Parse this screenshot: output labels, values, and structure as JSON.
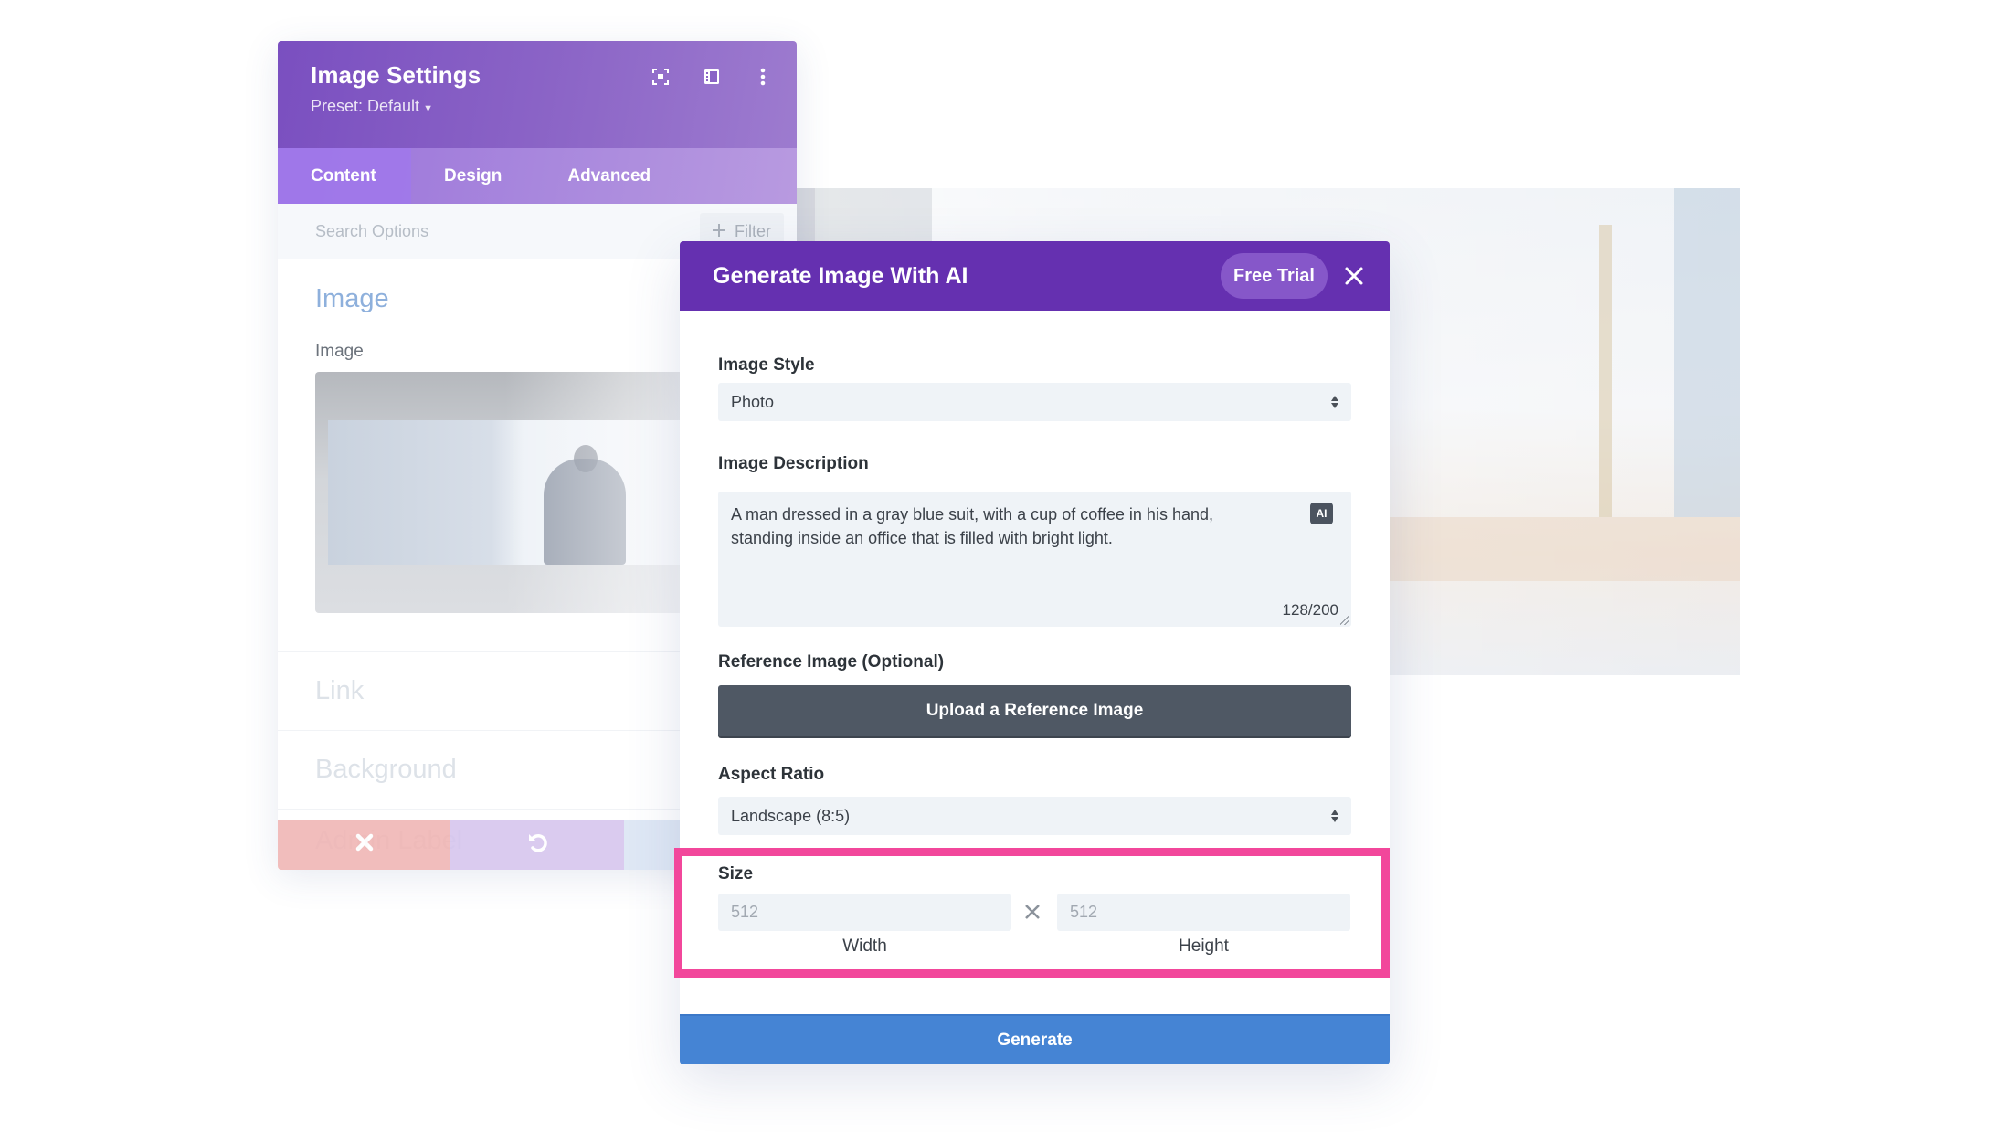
{
  "settings_panel": {
    "title": "Image Settings",
    "preset": "Preset: Default",
    "header_icons": [
      "focus-mode-icon",
      "sidebar-layout-icon",
      "more-options-icon"
    ],
    "tabs": [
      {
        "label": "Content",
        "active": true
      },
      {
        "label": "Design",
        "active": false
      },
      {
        "label": "Advanced",
        "active": false
      }
    ],
    "search_placeholder": "Search Options",
    "filter_label": "Filter",
    "sections": {
      "image_title": "Image",
      "image_field_label": "Image",
      "link": "Link",
      "background": "Background",
      "admin_label": "Admin Label"
    },
    "toolbar": [
      "cancel-icon",
      "undo-icon",
      "redo-icon"
    ]
  },
  "modal": {
    "title": "Generate Image With AI",
    "free_trial": "Free Trial",
    "image_style": {
      "label": "Image Style",
      "value": "Photo"
    },
    "image_description": {
      "label": "Image Description",
      "value": "A man dressed in a gray blue suit, with a cup of coffee in his hand, standing inside an office that is filled with bright light.",
      "ai_badge": "AI",
      "char_count": "128/200"
    },
    "reference_image": {
      "label": "Reference Image (Optional)",
      "button": "Upload a Reference Image"
    },
    "aspect_ratio": {
      "label": "Aspect Ratio",
      "value": "Landscape (8:5)"
    },
    "size": {
      "label": "Size",
      "width_placeholder": "512",
      "height_placeholder": "512",
      "width_label": "Width",
      "height_label": "Height"
    },
    "generate_button": "Generate"
  },
  "colors": {
    "modal_header": "#6530b0",
    "highlight": "#f2479b",
    "generate": "#4584d4",
    "upload": "#4f5864"
  }
}
